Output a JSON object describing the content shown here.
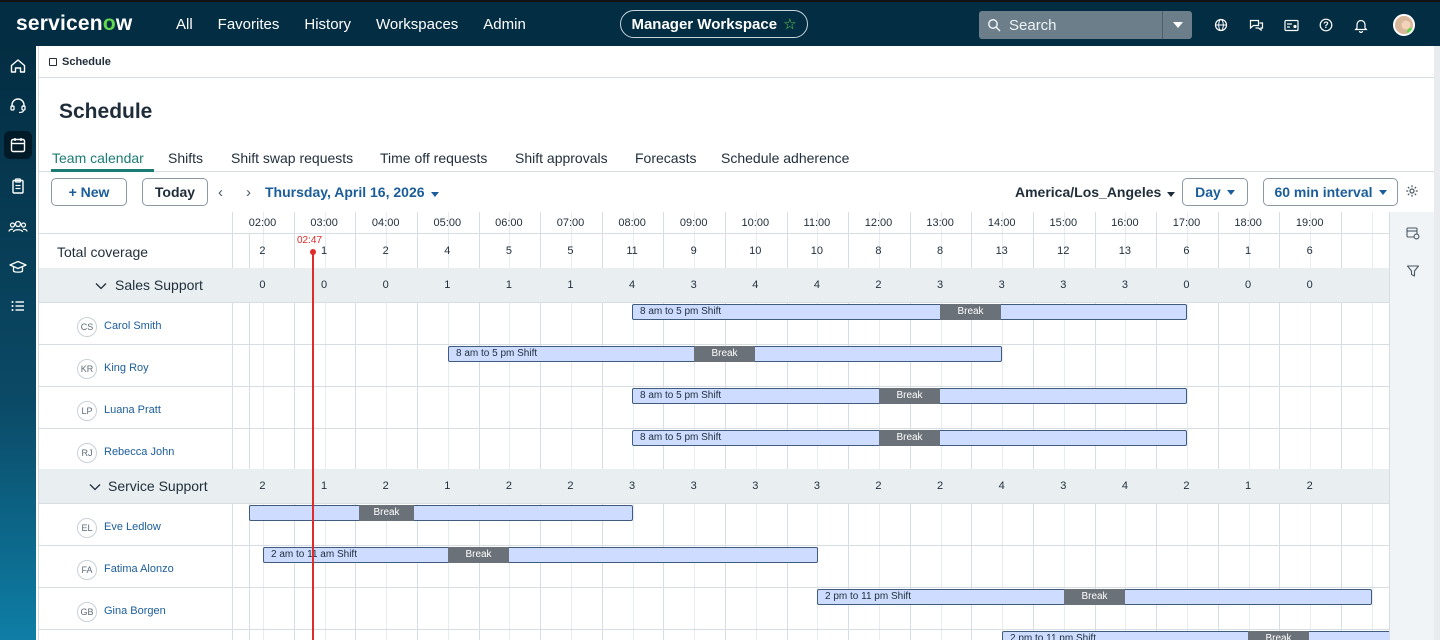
{
  "brand": {
    "logo_pre": "servicen",
    "logo_o": "o",
    "logo_post": "w"
  },
  "nav": [
    "All",
    "Favorites",
    "History",
    "Workspaces",
    "Admin"
  ],
  "workspace": {
    "label": "Manager Workspace",
    "star": "☆"
  },
  "search": {
    "placeholder": "Search"
  },
  "top_icons": [
    "globe-icon",
    "chat-icon",
    "id-card-icon",
    "help-icon",
    "bell-icon"
  ],
  "rail": [
    "home-icon",
    "headset-icon",
    "calendar-icon",
    "clipboard-icon",
    "team-icon",
    "graduation-icon",
    "list-icon"
  ],
  "breadcrumb": "Schedule",
  "page_title": "Schedule",
  "tabs": [
    "Team calendar",
    "Shifts",
    "Shift swap requests",
    "Time off requests",
    "Shift approvals",
    "Forecasts",
    "Schedule adherence"
  ],
  "toolbar": {
    "new_label": "+ New",
    "today_label": "Today",
    "date": "Thursday, April 16, 2026",
    "timezone": "America/Los_Angeles",
    "view": "Day",
    "interval": "60 min interval"
  },
  "hours": [
    "02:00",
    "03:00",
    "04:00",
    "05:00",
    "06:00",
    "07:00",
    "08:00",
    "09:00",
    "10:00",
    "11:00",
    "12:00",
    "13:00",
    "14:00",
    "15:00",
    "16:00",
    "17:00",
    "18:00",
    "19:00"
  ],
  "now_time": "02:47",
  "total_coverage": {
    "label": "Total coverage",
    "counts": [
      "2",
      "1",
      "2",
      "4",
      "5",
      "5",
      "11",
      "9",
      "10",
      "10",
      "8",
      "8",
      "13",
      "12",
      "13",
      "6",
      "1",
      "6"
    ]
  },
  "groups": [
    {
      "name": "Sales Support",
      "counts": [
        "0",
        "0",
        "0",
        "1",
        "1",
        "1",
        "4",
        "3",
        "4",
        "4",
        "2",
        "3",
        "3",
        "3",
        "3",
        "0",
        "0",
        "0"
      ],
      "agents": [
        {
          "initials": "CS",
          "name": "Carol Smith",
          "shift": "8 am to 5 pm Shift",
          "break": "Break"
        },
        {
          "initials": "KR",
          "name": "King Roy",
          "shift": "8 am to 5 pm Shift",
          "break": "Break"
        },
        {
          "initials": "LP",
          "name": "Luana Pratt",
          "shift": "8 am to 5 pm Shift",
          "break": "Break"
        },
        {
          "initials": "RJ",
          "name": "Rebecca John",
          "shift": "8 am to 5 pm Shift",
          "break": "Break"
        }
      ]
    },
    {
      "name": "Service Support",
      "counts": [
        "2",
        "1",
        "2",
        "1",
        "2",
        "2",
        "3",
        "3",
        "3",
        "3",
        "2",
        "2",
        "4",
        "3",
        "4",
        "2",
        "1",
        "2"
      ],
      "agents": [
        {
          "initials": "EL",
          "name": "Eve Ledlow",
          "shift": "",
          "break": "Break"
        },
        {
          "initials": "FA",
          "name": "Fatima Alonzo",
          "shift": "2 am to 11 am Shift",
          "break": "Break"
        },
        {
          "initials": "GB",
          "name": "Gina Borgen",
          "shift": "2 pm to 11 pm Shift",
          "break": "Break"
        },
        {
          "initials": "",
          "name": "",
          "shift": "2 pm to 11 pm Shift",
          "break": "Break"
        }
      ]
    }
  ],
  "colors": {
    "topbar": "#032d42",
    "accent_green": "#62d84e",
    "link_blue": "#1b5d9a",
    "tab_active": "#1b7a74",
    "shift_fill": "#cddcff",
    "break_fill": "#6b7178",
    "now_line": "#e02b2b"
  }
}
